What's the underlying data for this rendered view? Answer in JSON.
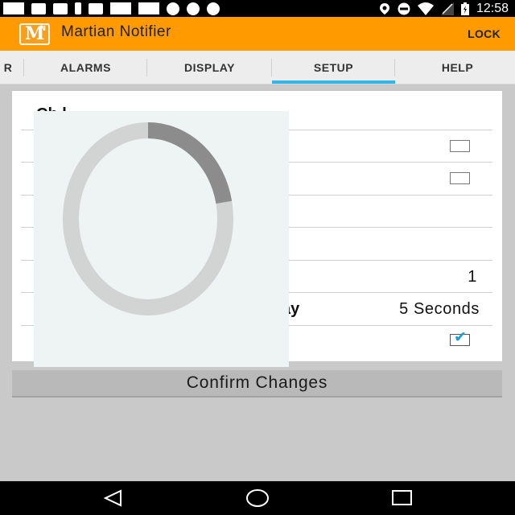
{
  "status_bar": {
    "time": "12:58",
    "left_icons": [
      "message-icon",
      "flipboard-icon",
      "flipboard-icon",
      "person-icon",
      "flipboard-icon",
      "image-icon",
      "image-icon",
      "dollar-icon",
      "dollar-icon",
      "dollar-icon"
    ],
    "right_icons": [
      "location-icon",
      "minus-circle-icon",
      "wifi-icon",
      "signal-icon",
      "battery-icon"
    ]
  },
  "app_bar": {
    "logo_letter": "M",
    "logo_superscript": "N",
    "title": "Martian Notifier",
    "lock_label": "LOCK",
    "background": "#ff9a00"
  },
  "tabs": {
    "items": [
      {
        "label": "R"
      },
      {
        "label": "ALARMS"
      },
      {
        "label": "DISPLAY"
      },
      {
        "label": "SETUP",
        "selected": true
      },
      {
        "label": "HELP"
      }
    ],
    "indicator_color": "#33b5e5"
  },
  "card": {
    "title_partial": "Ch         l",
    "rows": [
      {
        "type": "checkbox",
        "checked": false
      },
      {
        "type": "checkbox",
        "checked": false
      },
      {
        "type": "empty"
      },
      {
        "type": "empty"
      },
      {
        "type": "value",
        "value": "1"
      },
      {
        "type": "label_value",
        "label_partial": "ay",
        "value": "5 Seconds"
      },
      {
        "type": "checkbox",
        "checked": true
      }
    ]
  },
  "progress_overlay": {
    "visible": true,
    "progress_fraction": 0.22
  },
  "confirm_button": {
    "label": "Confirm Changes"
  },
  "nav_bar": {
    "buttons": [
      "back-icon",
      "home-icon",
      "recents-icon"
    ]
  }
}
